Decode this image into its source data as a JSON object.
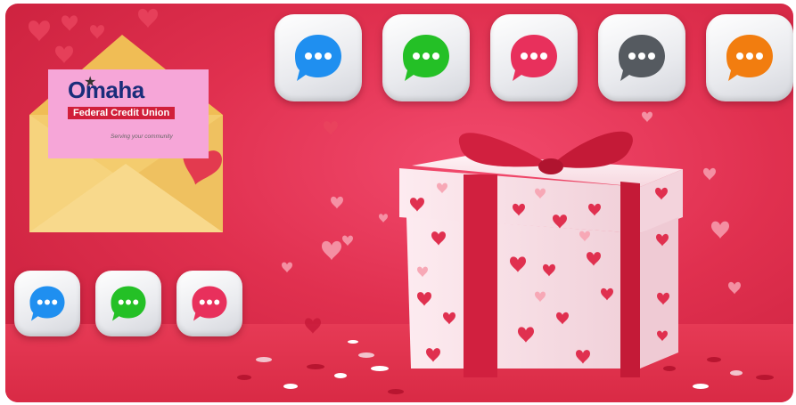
{
  "logo": {
    "name_prefix": "O",
    "name_rest": "maha",
    "subtitle": "Federal Credit Union",
    "tagline": "Serving your community"
  },
  "top_chat_icons": [
    "blue-chat-bubble-icon",
    "green-chat-bubble-icon",
    "pink-chat-bubble-icon",
    "gray-chat-bubble-icon",
    "orange-chat-bubble-icon"
  ],
  "bottom_chat_icons": [
    "blue-chat-bubble-icon",
    "green-chat-bubble-icon",
    "pink-chat-bubble-icon"
  ],
  "colors": {
    "background": "#e0304f",
    "blue": "#1f8ff0",
    "green": "#24c026",
    "pink": "#e8305c",
    "gray": "#555a60",
    "orange": "#f27d0f",
    "ribbon": "#d1203f",
    "gift_box": "#fbe4ea",
    "envelope": "#f4cc6e"
  }
}
